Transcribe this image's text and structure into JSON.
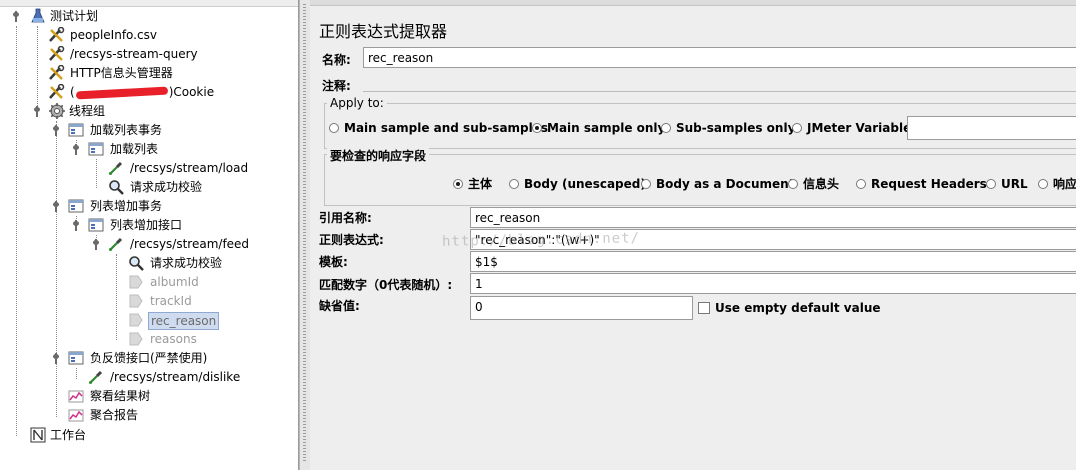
{
  "tree": {
    "items": [
      {
        "label": "测试计划",
        "icon": "test-plan-flask-icon"
      },
      {
        "label": "peopleInfo.csv",
        "icon": "config-wrench-icon"
      },
      {
        "label": "/recsys-stream-query",
        "icon": "config-wrench-icon"
      },
      {
        "label": "HTTP信息头管理器",
        "icon": "config-wrench-icon"
      },
      {
        "label_prefix": "(",
        "label_suffix": ")Cookie",
        "icon": "config-wrench-icon"
      },
      {
        "label": "线程组",
        "icon": "thread-group-gear-icon"
      },
      {
        "label": "加载列表事务",
        "icon": "controller-icon"
      },
      {
        "label": "加载列表",
        "icon": "controller-icon"
      },
      {
        "label": "/recsys/stream/load",
        "icon": "sampler-pipette-icon"
      },
      {
        "label": "请求成功校验",
        "icon": "assertion-magnifier-icon"
      },
      {
        "label": "列表增加事务",
        "icon": "controller-icon"
      },
      {
        "label": "列表增加接口",
        "icon": "controller-icon"
      },
      {
        "label": "/recsys/stream/feed",
        "icon": "sampler-pipette-icon"
      },
      {
        "label": "请求成功校验",
        "icon": "assertion-magnifier-icon"
      },
      {
        "label": "albumId",
        "icon": "postprocessor-tag-icon"
      },
      {
        "label": "trackId",
        "icon": "postprocessor-tag-icon"
      },
      {
        "label": "rec_reason",
        "icon": "postprocessor-tag-icon"
      },
      {
        "label": "reasons",
        "icon": "postprocessor-tag-icon"
      },
      {
        "label": "负反馈接口(严禁使用)",
        "icon": "controller-icon"
      },
      {
        "label": "/recsys/stream/dislike",
        "icon": "sampler-pipette-icon"
      },
      {
        "label": "察看结果树",
        "icon": "listener-graph-icon"
      },
      {
        "label": "聚合报告",
        "icon": "listener-graph-icon"
      },
      {
        "label": "工作台",
        "icon": "workbench-icon"
      }
    ]
  },
  "editor": {
    "title": "正则表达式提取器",
    "name_label": "名称:",
    "name_value": "rec_reason",
    "comment_label": "注释:",
    "apply_to": {
      "title": "Apply to:",
      "options": [
        "Main sample and sub-samples",
        "Main sample only",
        "Sub-samples only",
        "JMeter Variable"
      ],
      "selected": "Main sample only"
    },
    "response_field": {
      "title": "要检查的响应字段",
      "options": [
        "主体",
        "Body (unescaped)",
        "Body as a Document",
        "信息头",
        "Request Headers",
        "URL",
        "响应"
      ],
      "selected": "主体"
    },
    "ref_name_label": "引用名称:",
    "ref_name_value": "rec_reason",
    "regex_label": "正则表达式:",
    "regex_value": "\"rec_reason\":\"(\\w+)\"",
    "template_label": "模板:",
    "template_value": "$1$",
    "match_no_label": "匹配数字（0代表随机）:",
    "match_no_value": "1",
    "default_label": "缺省值:",
    "default_value": "0",
    "use_empty_default_label": "Use empty default value",
    "watermark": "http://blog.csdn.net/"
  }
}
